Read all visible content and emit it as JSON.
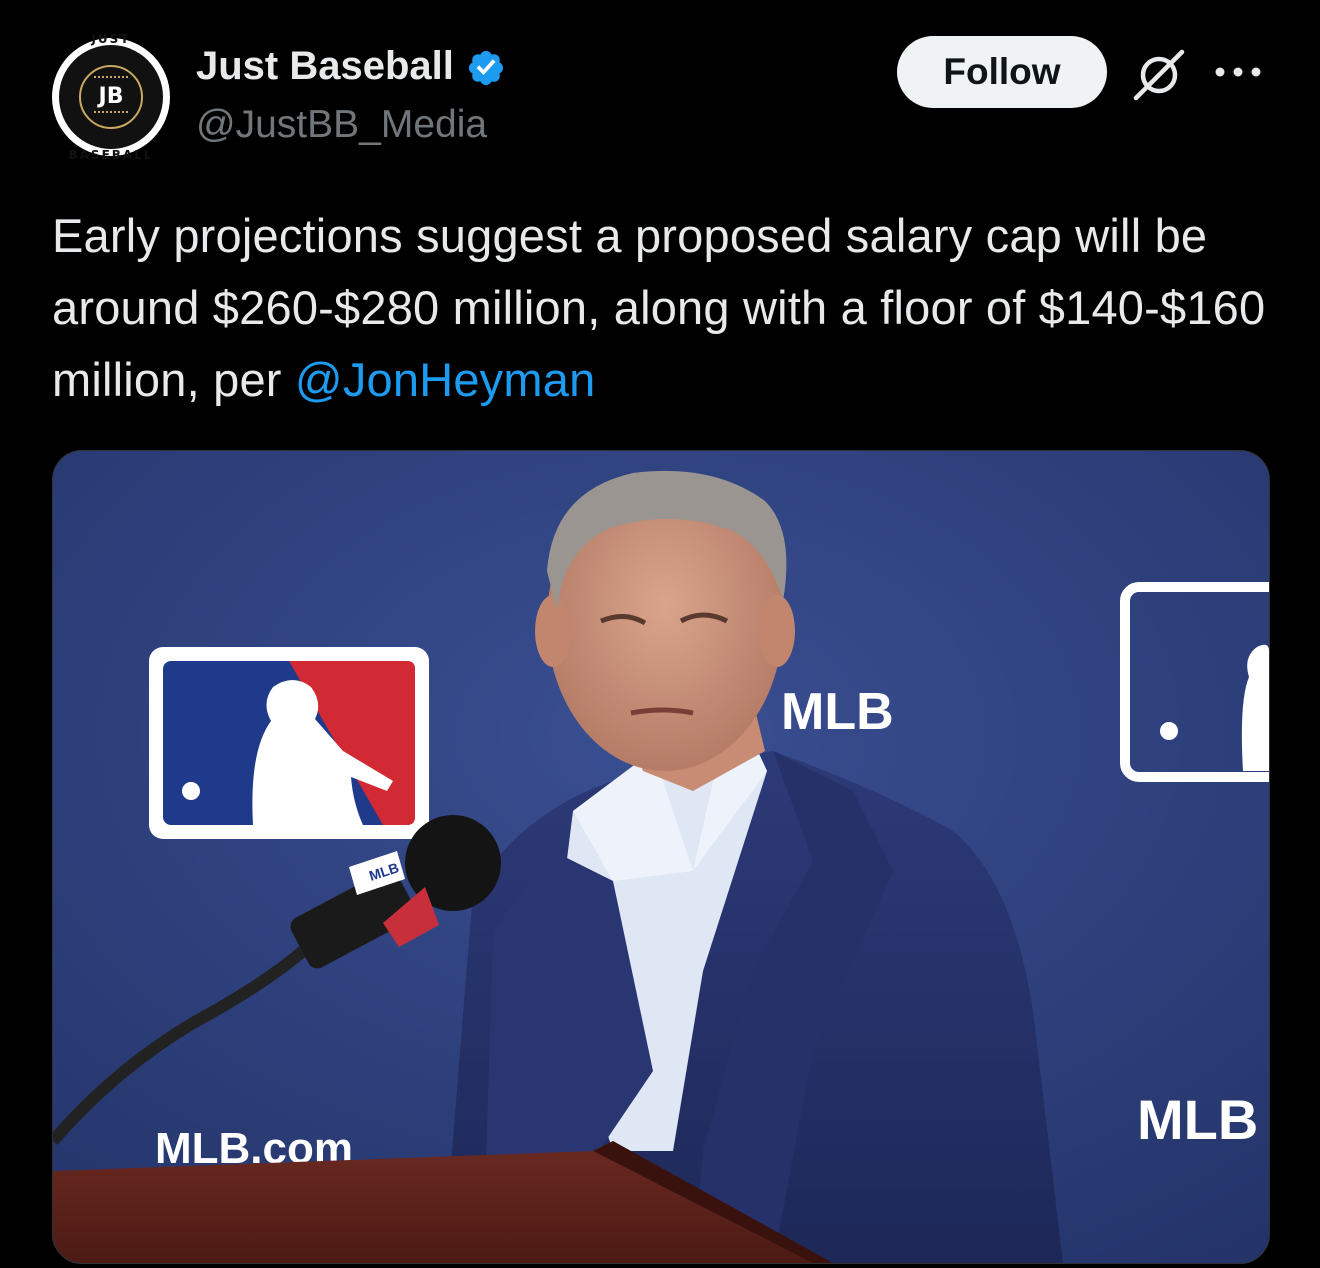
{
  "author": {
    "display_name": "Just Baseball",
    "handle": "@JustBB_Media",
    "verified": true,
    "avatar": {
      "ring_top": "JUST",
      "monogram": "JB",
      "ring_bottom": "BASEBALL"
    }
  },
  "actions": {
    "follow_label": "Follow",
    "grok_icon": "grok-icon",
    "more_icon": "more-horizontal-icon"
  },
  "post": {
    "text_before_mention": "Early projections suggest a proposed salary cap will be around $260-$280 million, along with a floor of $140-$160 million, per ",
    "mention": "@JonHeyman"
  },
  "media": {
    "backdrop_logo_texts": [
      "MLB",
      "MLB",
      "MLB.com"
    ],
    "mic_flag_text": "MLB"
  },
  "colors": {
    "background": "#000000",
    "text_primary": "#e7e9ea",
    "text_secondary": "#71767b",
    "accent": "#1d9bf0",
    "follow_bg": "#eff3f4",
    "backdrop_blue": "#2b3d78"
  }
}
